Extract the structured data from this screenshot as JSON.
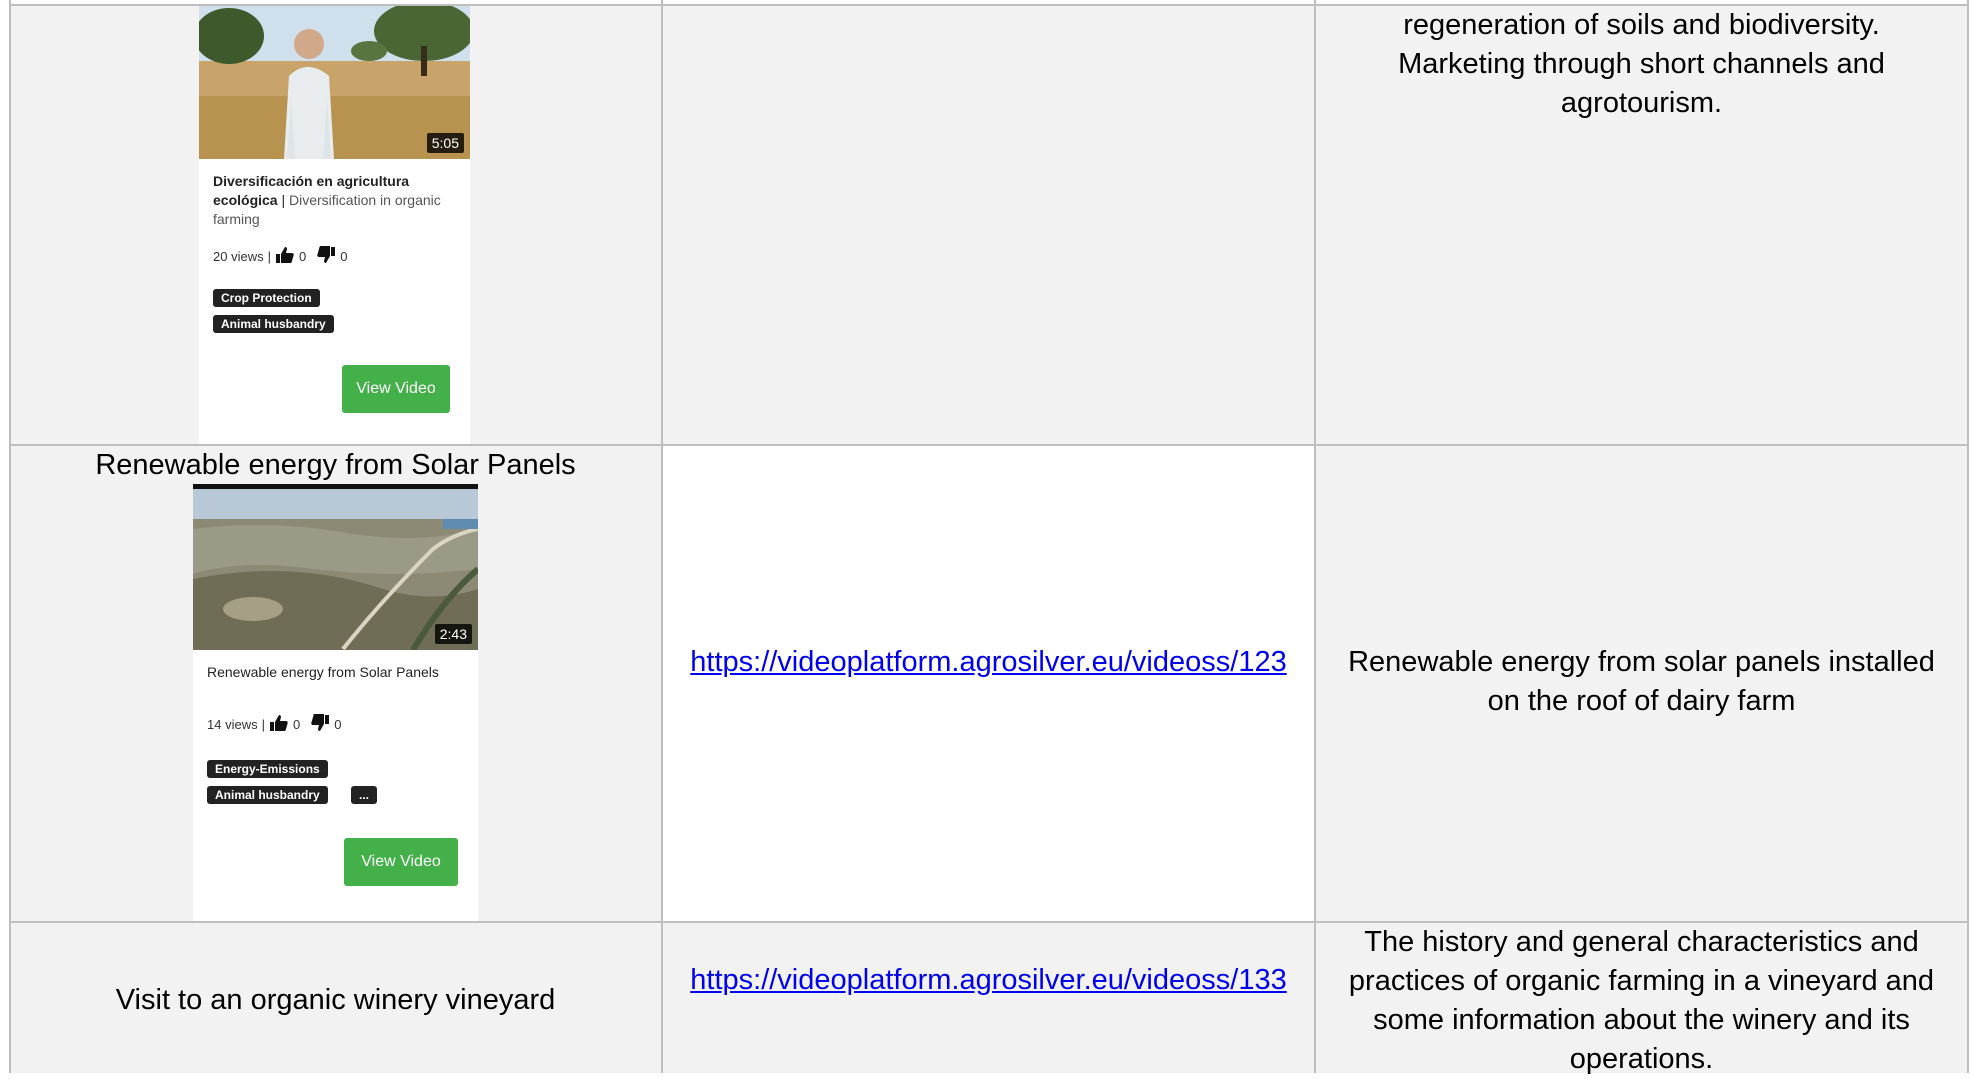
{
  "rows": [
    {
      "card": {
        "title_bold": "Diversificación en agricultura ecológica",
        "title_rest": "Diversification in organic farming",
        "duration": "5:05",
        "views": "20 views",
        "likes": "0",
        "dislikes": "0",
        "tags": [
          "Crop Protection",
          "Animal husbandry"
        ],
        "button": "View Video"
      },
      "link": "",
      "description": "regeneration of soils and biodiversity. Marketing through short channels and agrotourism."
    },
    {
      "title": "Renewable energy from Solar Panels",
      "card": {
        "title_bold": "",
        "title_rest": "Renewable energy from Solar Panels",
        "duration": "2:43",
        "views": "14 views",
        "likes": "0",
        "dislikes": "0",
        "tags": [
          "Energy-Emissions",
          "Animal husbandry"
        ],
        "more_tag": "...",
        "button": "View Video"
      },
      "link": "https://videoplatform.agrosilver.eu/videoss/123",
      "description": "Renewable energy from solar panels installed on the roof of dairy farm"
    },
    {
      "title": "Visit to an organic winery vineyard",
      "link": "https://videoplatform.agrosilver.eu/videoss/133",
      "description": "The history and general characteristics and practices of organic farming in a vineyard and some information about the winery and its operations."
    }
  ],
  "colors": {
    "link": "#0000ee",
    "button": "#43b049",
    "tag": "#222222",
    "cell_gray": "#f2f2f2"
  },
  "icons": [
    "thumbs-up-icon",
    "thumbs-down-icon"
  ]
}
